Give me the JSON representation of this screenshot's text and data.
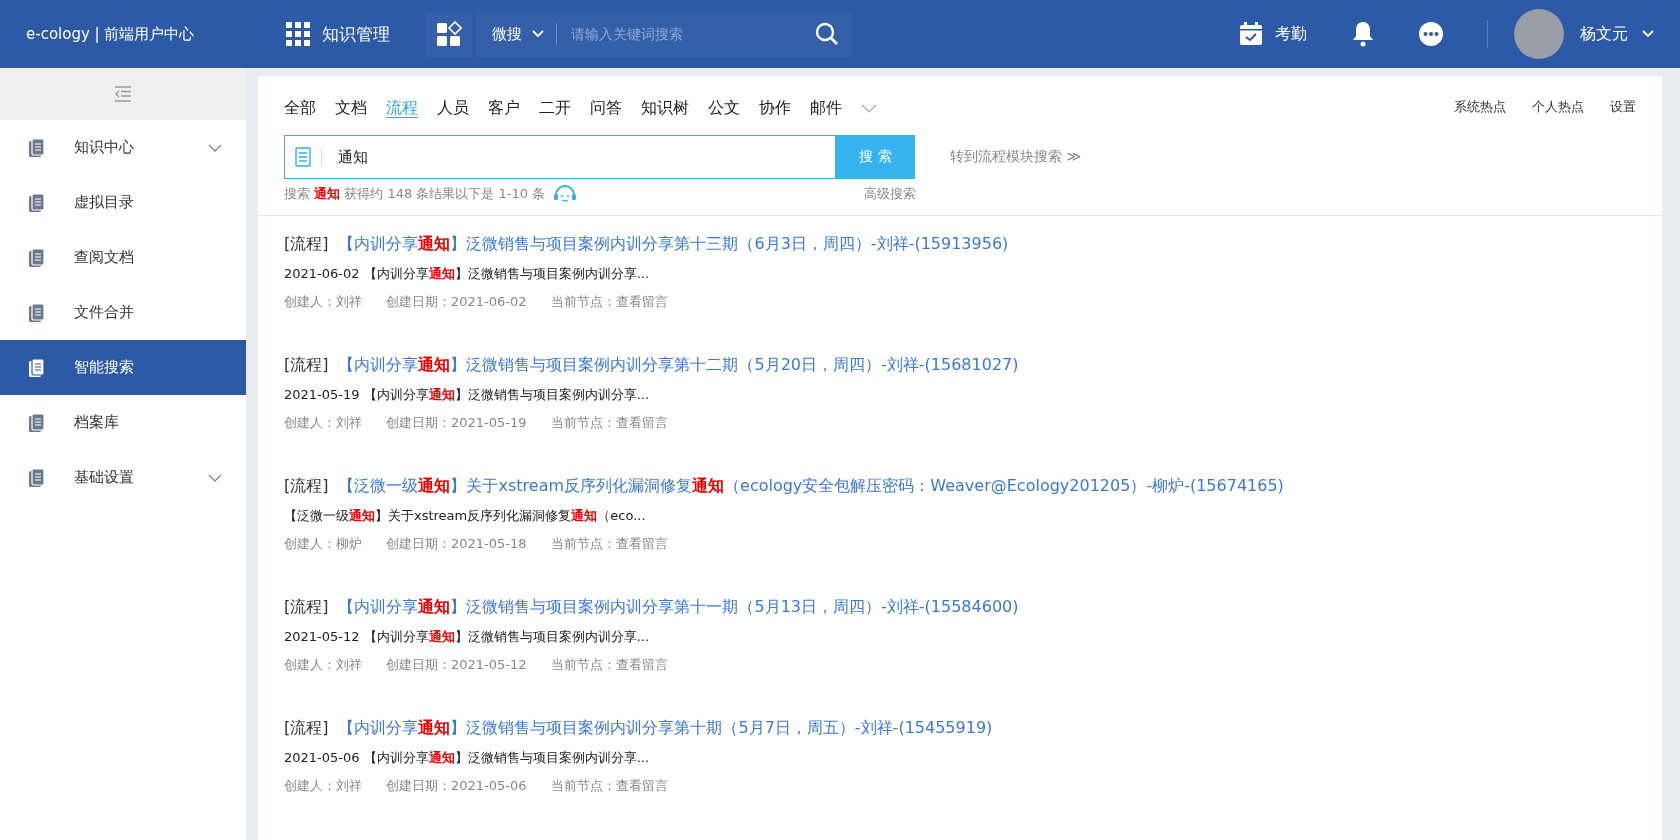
{
  "header": {
    "brand": "e-cology | 前端用户中心",
    "module": "知识管理",
    "search_scope": "微搜",
    "search_placeholder": "请输入关键词搜索",
    "attendance": "考勤",
    "user": "杨文元"
  },
  "sidebar": {
    "items": [
      {
        "label": "知识中心",
        "selected": false,
        "expandable": true
      },
      {
        "label": "虚拟目录",
        "selected": false,
        "expandable": false
      },
      {
        "label": "查阅文档",
        "selected": false,
        "expandable": false
      },
      {
        "label": "文件合并",
        "selected": false,
        "expandable": false
      },
      {
        "label": "智能搜索",
        "selected": true,
        "expandable": false
      },
      {
        "label": "档案库",
        "selected": false,
        "expandable": false
      },
      {
        "label": "基础设置",
        "selected": false,
        "expandable": true
      }
    ]
  },
  "tabs": [
    {
      "label": "全部",
      "selected": false
    },
    {
      "label": "文档",
      "selected": false
    },
    {
      "label": "流程",
      "selected": true
    },
    {
      "label": "人员",
      "selected": false
    },
    {
      "label": "客户",
      "selected": false
    },
    {
      "label": "二开",
      "selected": false
    },
    {
      "label": "问答",
      "selected": false
    },
    {
      "label": "知识树",
      "selected": false
    },
    {
      "label": "公文",
      "selected": false
    },
    {
      "label": "协作",
      "selected": false
    },
    {
      "label": "邮件",
      "selected": false
    }
  ],
  "top_links": [
    "系统热点",
    "个人热点",
    "设置"
  ],
  "search": {
    "value": "通知",
    "button": "搜 索",
    "module_link": "转到流程模块搜索 ≫",
    "summary": "搜索 **通知** 获得约 148 条结果以下是 1-10 条",
    "advanced": "高级搜索"
  },
  "results": [
    {
      "tag": "[流程]",
      "title": "【内训分享**通知**】泛微销售与项目案例内训分享第十三期（6月3日，周四）-刘祥-(15913956)",
      "snippet": "2021-06-02 【内训分享**通知**】泛微销售与项目案例内训分享...",
      "creator": "创建人：刘祥",
      "created": "创建日期：2021-06-02",
      "node": "当前节点：查看留言"
    },
    {
      "tag": "[流程]",
      "title": "【内训分享**通知**】泛微销售与项目案例内训分享第十二期（5月20日，周四）-刘祥-(15681027)",
      "snippet": "2021-05-19 【内训分享**通知**】泛微销售与项目案例内训分享...",
      "creator": "创建人：刘祥",
      "created": "创建日期：2021-05-19",
      "node": "当前节点：查看留言"
    },
    {
      "tag": "[流程]",
      "title": "【泛微一级**通知**】关于xstream反序列化漏洞修复**通知**（ecology安全包解压密码：Weaver@Ecology201205）-柳炉-(15674165)",
      "snippet": "【泛微一级**通知**】关于xstream反序列化漏洞修复**通知**（eco...",
      "creator": "创建人：柳炉",
      "created": "创建日期：2021-05-18",
      "node": "当前节点：查看留言"
    },
    {
      "tag": "[流程]",
      "title": "【内训分享**通知**】泛微销售与项目案例内训分享第十一期（5月13日，周四）-刘祥-(15584600)",
      "snippet": "2021-05-12 【内训分享**通知**】泛微销售与项目案例内训分享...",
      "creator": "创建人：刘祥",
      "created": "创建日期：2021-05-12",
      "node": "当前节点：查看留言"
    },
    {
      "tag": "[流程]",
      "title": "【内训分享**通知**】泛微销售与项目案例内训分享第十期（5月7日，周五）-刘祥-(15455919)",
      "snippet": "2021-05-06 【内训分享**通知**】泛微销售与项目案例内训分享...",
      "creator": "创建人：刘祥",
      "created": "创建日期：2021-05-06",
      "node": "当前节点：查看留言"
    }
  ]
}
